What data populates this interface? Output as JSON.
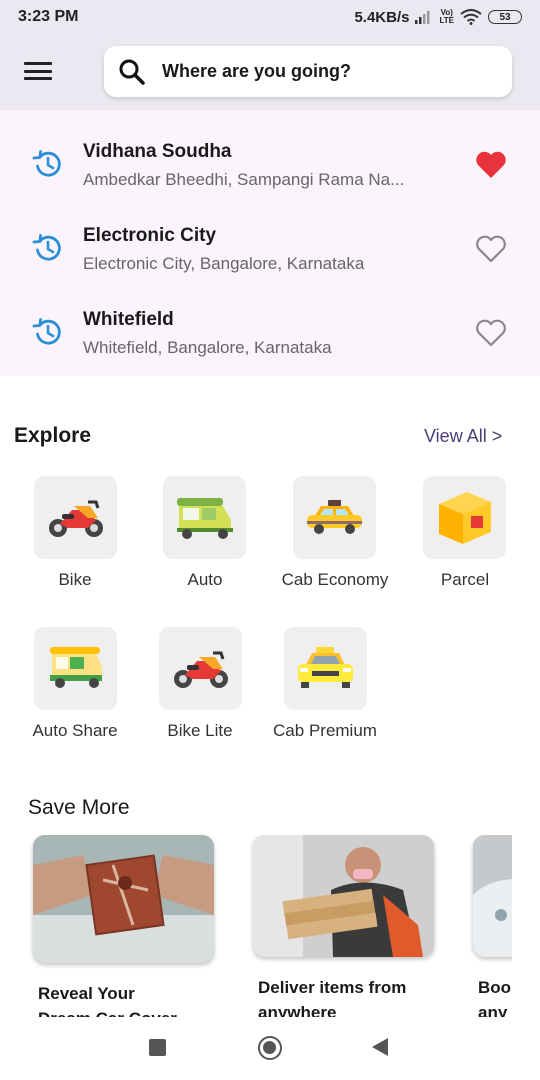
{
  "status_bar": {
    "time": "3:23 PM",
    "network_speed": "5.4KB/s",
    "volte_top": "Vo)",
    "volte_bottom": "LTE",
    "battery": "53"
  },
  "header": {
    "menu_icon": "hamburger-menu-icon",
    "search_placeholder": "Where are you going?"
  },
  "recent_places": [
    {
      "title": "Vidhana Soudha",
      "subtitle": "Ambedkar Bheedhi, Sampangi Rama Na...",
      "favorite": true
    },
    {
      "title": "Electronic City",
      "subtitle": "Electronic City, Bangalore, Karnataka",
      "favorite": false
    },
    {
      "title": "Whitefield",
      "subtitle": "Whitefield, Bangalore, Karnataka",
      "favorite": false
    }
  ],
  "explore": {
    "title": "Explore",
    "view_all": "View All >",
    "services": [
      {
        "label": "Bike",
        "icon": "bike-icon"
      },
      {
        "label": "Auto",
        "icon": "auto-rickshaw-icon"
      },
      {
        "label": "Cab Economy",
        "icon": "taxi-icon"
      },
      {
        "label": "Parcel",
        "icon": "parcel-box-icon"
      },
      {
        "label": "Auto Share",
        "icon": "auto-share-icon"
      },
      {
        "label": "Bike Lite",
        "icon": "bike-lite-icon"
      },
      {
        "label": "Cab Premium",
        "icon": "premium-taxi-icon"
      }
    ]
  },
  "save_more": {
    "title": "Save More",
    "cards": [
      {
        "line1": "Reveal Your",
        "line2": "Dream Car Cover"
      },
      {
        "line1": "Deliver items from",
        "line2": "anywhere"
      },
      {
        "line1": "Boo",
        "line2": "any"
      }
    ]
  },
  "colors": {
    "header_bg": "#ece8f1",
    "recent_bg": "#fcf4fc",
    "heart_active": "#e8323c",
    "clock_blue": "#2a8fd6",
    "view_all": "#4d3d7a"
  }
}
